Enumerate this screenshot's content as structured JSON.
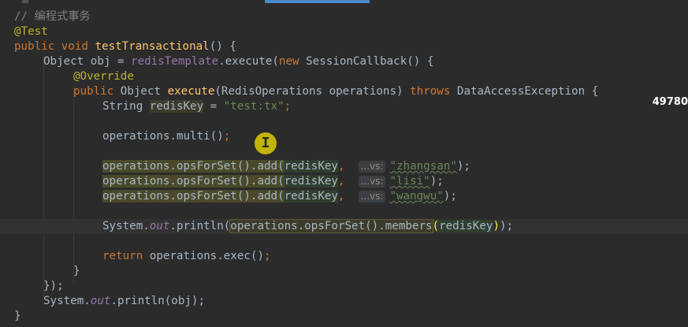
{
  "editor": {
    "lines": {
      "l1_comment": "// 编程式事务",
      "l2_annotation": "@Test",
      "l3_kw1": "public",
      "l3_kw2": "void",
      "l3_fn": "testTransactional",
      "l3_rest": "() {",
      "l4_type": "Object obj = ",
      "l4_field": "redisTemplate",
      "l4_call": ".execute(",
      "l4_new": "new",
      "l4_rest": " SessionCallback() {",
      "l5_annotation": "@Override",
      "l6_kw": "public",
      "l6_type": " Object ",
      "l6_fn": "execute",
      "l6_params": "(RedisOperations operations) ",
      "l6_throws": "throws",
      "l6_rest": " DataAccessException {",
      "l7_type": "String ",
      "l7_var": "redisKey",
      "l7_eq": " = ",
      "l7_str": "\"test:tx\"",
      "l7_end": ";",
      "l9_code": "operations.multi()",
      "l9_end": ";",
      "l11_call": "operations.opsForSet().add(",
      "l11_arg": "redisKey",
      "l11_comma": ", ",
      "l11_hint": "...vs:",
      "l11_str": "\"zhangsan\"",
      "l11_end": ");",
      "l12_call": "operations.opsForSet().add(",
      "l12_arg": "redisKey",
      "l12_comma": ", ",
      "l12_hint": "...vs:",
      "l12_str": "\"lisi\"",
      "l12_end": ");",
      "l13_call": "operations.opsForSet().add(",
      "l13_arg": "redisKey",
      "l13_comma": ", ",
      "l13_hint": "...vs:",
      "l13_str": "\"wangwu\"",
      "l13_end": ");",
      "l15_sys": "System.",
      "l15_out": "out",
      "l15_println": ".println(",
      "l15_inner": "operations.opsForSet().members",
      "l15_open": "(",
      "l15_arg": "redisKey",
      "l15_close": ")",
      "l15_end": ");",
      "l17_kw": "return",
      "l17_rest": " operations.exec()",
      "l17_end": ";",
      "l18_brace": "}",
      "l19_close": "});",
      "l20_sys": "System.",
      "l20_out": "out",
      "l20_rest": ".println(obj);",
      "l21_brace": "}"
    }
  },
  "side_number": "49780",
  "colors": {
    "background": "#2b2b2b",
    "keyword": "#cc7832",
    "annotation": "#bbb529",
    "string": "#6a8759",
    "function": "#ffc66d",
    "static_field": "#9876aa",
    "comment": "#808080",
    "accent": "#4a88c7"
  }
}
